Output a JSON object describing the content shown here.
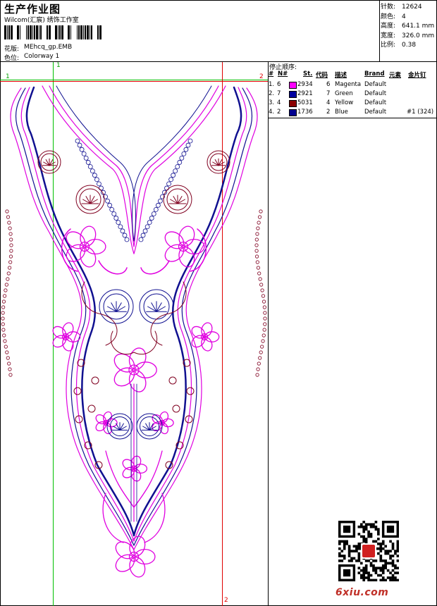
{
  "header": {
    "title": "生产作业图",
    "company": "Wilcom(汇宸) 绣饰工作室",
    "design_label": "花版:",
    "design_value": "MEhcq_gp.EMB",
    "colorway_label": "色位:",
    "colorway_value": "Colorway 1"
  },
  "stats": [
    {
      "label": "针数:",
      "value": "12624"
    },
    {
      "label": "颜色:",
      "value": "4"
    },
    {
      "label": "高度:",
      "value": "641.1 mm"
    },
    {
      "label": "宽度:",
      "value": "326.0 mm"
    },
    {
      "label": "比例:",
      "value": "0.38"
    }
  ],
  "stop_table": {
    "title": "停止顺序:",
    "columns": [
      "#",
      "N#",
      "St.",
      "代码",
      "描述",
      "Brand",
      "元素",
      "金片钉"
    ],
    "rows": [
      {
        "idx": "1.",
        "n": "6",
        "color": "#ff00ff",
        "st": "2934",
        "code": "6",
        "desc": "Magenta",
        "brand": "Default",
        "extra": ""
      },
      {
        "idx": "2.",
        "n": "7",
        "color": "#0000a0",
        "st": "2921",
        "code": "7",
        "desc": "Green",
        "brand": "Default",
        "extra": ""
      },
      {
        "idx": "3.",
        "n": "4",
        "color": "#8b0000",
        "st": "5031",
        "code": "4",
        "desc": "Yellow",
        "brand": "Default",
        "extra": ""
      },
      {
        "idx": "4.",
        "n": "2",
        "color": "#000090",
        "st": "1736",
        "code": "2",
        "desc": "Blue",
        "brand": "Default",
        "extra": "#1 (324)"
      }
    ]
  },
  "markers": {
    "h1": "1",
    "h2": "2",
    "v1": "1",
    "v2": "2"
  },
  "watermark": {
    "text": "6xiu.com"
  },
  "palette": {
    "magenta": "#e000e0",
    "blue": "#101090",
    "maroon": "#800020",
    "green_guide": "#00c000",
    "red_guide": "#e00000"
  }
}
